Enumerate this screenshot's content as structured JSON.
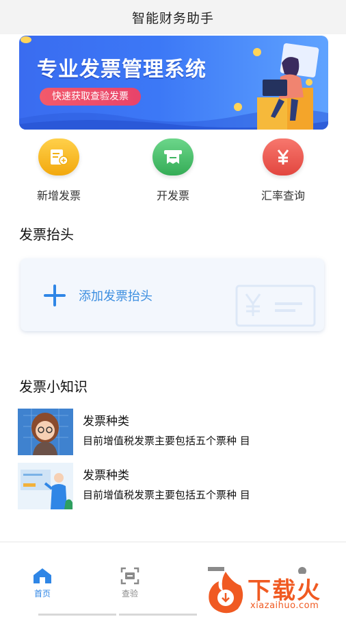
{
  "app": {
    "title": "智能财务助手"
  },
  "banner": {
    "headline": "专业发票管理系统",
    "cta": "快速获取查验发票"
  },
  "quick_actions": [
    {
      "label": "新增发票",
      "icon": "new-invoice-icon",
      "color": "#f5b91c"
    },
    {
      "label": "开发票",
      "icon": "issue-invoice-icon",
      "color": "#4fc36b"
    },
    {
      "label": "汇率查询",
      "icon": "yen-rate-icon",
      "color": "#ef5a52"
    }
  ],
  "invoice_header": {
    "section_title": "发票抬头",
    "add_label": "添加发票抬头"
  },
  "knowledge": {
    "section_title": "发票小知识",
    "items": [
      {
        "title": "发票种类",
        "desc": "目前增值税发票主要包括五个票种 目"
      },
      {
        "title": "发票种类",
        "desc": "目前增值税发票主要包括五个票种 目"
      }
    ]
  },
  "tabbar": {
    "tabs": [
      {
        "label": "首页",
        "active": true
      },
      {
        "label": "查验",
        "active": false
      }
    ]
  },
  "watermark": {
    "brand": "下载火",
    "url": "xiazaihuo.com"
  },
  "colors": {
    "accent": "#2f86e6",
    "banner": "#3c78f6",
    "watermark": "#f05a22"
  }
}
